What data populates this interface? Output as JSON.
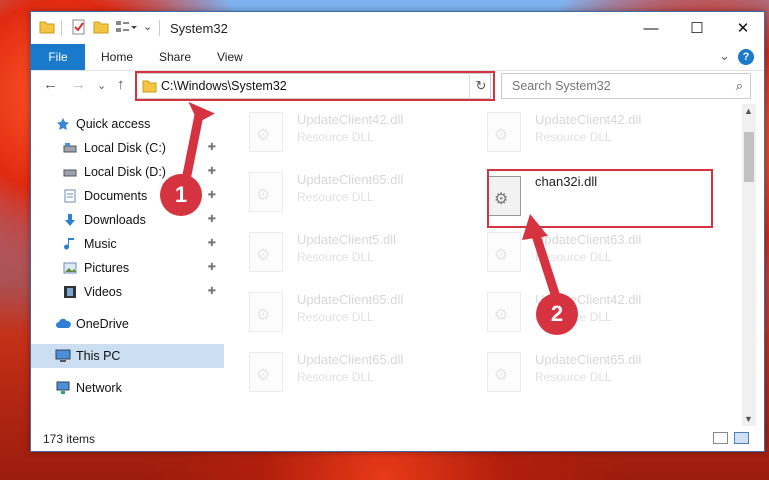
{
  "window": {
    "title": "System32",
    "minimize": "—",
    "maximize": "☐",
    "close": "✕"
  },
  "ribbon": {
    "tabs": [
      "File",
      "Home",
      "Share",
      "View"
    ],
    "expand": "⌄",
    "help": "?"
  },
  "nav": {
    "back": "←",
    "forward": "→",
    "recent": "⌄",
    "up": "↑",
    "address": "C:\\Windows\\System32",
    "address_dropdown": "⌄",
    "refresh": "↻",
    "search_placeholder": "Search System32",
    "search_icon": "⌕"
  },
  "sidebar": {
    "items": [
      {
        "label": "Quick access",
        "icon": "star-icon",
        "pinned": false
      },
      {
        "label": "Local Disk (C:)",
        "icon": "drive-icon",
        "pinned": true
      },
      {
        "label": "Local Disk (D:)",
        "icon": "drive-icon",
        "pinned": true
      },
      {
        "label": "Documents",
        "icon": "documents-icon",
        "pinned": true
      },
      {
        "label": "Downloads",
        "icon": "downloads-icon",
        "pinned": true
      },
      {
        "label": "Music",
        "icon": "music-icon",
        "pinned": true
      },
      {
        "label": "Pictures",
        "icon": "pictures-icon",
        "pinned": true
      },
      {
        "label": "Videos",
        "icon": "videos-icon",
        "pinned": true
      },
      {
        "label": "OneDrive",
        "icon": "cloud-icon",
        "pinned": false
      },
      {
        "label": "This PC",
        "icon": "pc-icon",
        "pinned": false,
        "selected": true
      },
      {
        "label": "Network",
        "icon": "network-icon",
        "pinned": false
      }
    ],
    "pin_glyph": "📌"
  },
  "files": [
    {
      "name": "UpdateClient42.dll",
      "type": "Resource DLL"
    },
    {
      "name": "UpdateClient42.dll",
      "type": "Resource DLL"
    },
    {
      "name": "UpdateClient65.dll",
      "type": "Resource DLL"
    },
    {
      "name": "chan32i.dll",
      "type": "",
      "highlighted": true
    },
    {
      "name": "UpdateClient5.dll",
      "type": "Resource DLL"
    },
    {
      "name": "UpdateClient63.dll",
      "type": "Resource DLL"
    },
    {
      "name": "UpdateClient65.dll",
      "type": "Resource DLL"
    },
    {
      "name": "UpdateClient42.dll",
      "type": "Resource DLL"
    },
    {
      "name": "UpdateClient65.dll",
      "type": "Resource DLL"
    },
    {
      "name": "UpdateClient65.dll",
      "type": "Resource DLL"
    }
  ],
  "status": {
    "items": "173 items"
  },
  "callouts": {
    "step1": "1",
    "step2": "2",
    "color": "#d63340"
  },
  "colors": {
    "accent": "#1979ca",
    "selected_bg": "#ccdef2",
    "callout": "#d63340"
  }
}
